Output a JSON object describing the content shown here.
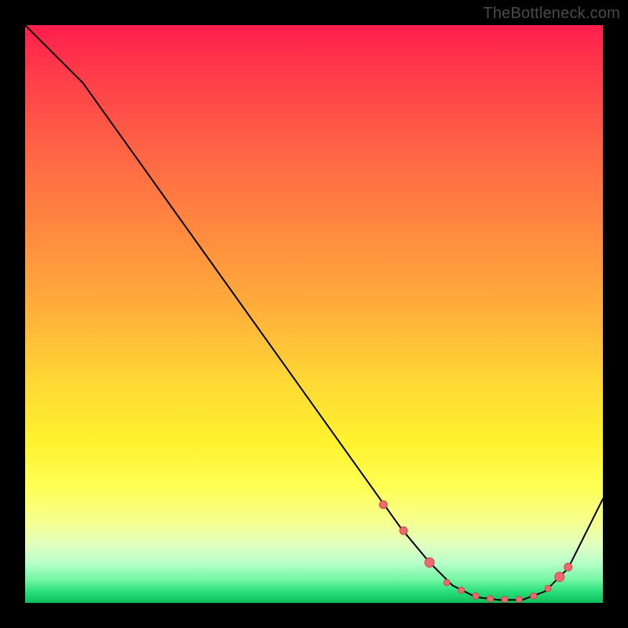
{
  "watermark": "TheBottleneck.com",
  "chart_data": {
    "type": "line",
    "title": "",
    "xlabel": "",
    "ylabel": "",
    "xlim": [
      0,
      100
    ],
    "ylim": [
      0,
      100
    ],
    "grid": false,
    "legend": false,
    "series": [
      {
        "name": "curve",
        "x": [
          0,
          6,
          10,
          20,
          30,
          40,
          50,
          60,
          65,
          70,
          74,
          78,
          82,
          86,
          90,
          94,
          100
        ],
        "values": [
          100,
          94,
          90,
          76,
          62,
          48,
          34,
          20,
          13,
          7,
          3,
          1,
          0.5,
          0.5,
          2,
          6,
          18
        ]
      }
    ],
    "markers": {
      "name": "dots",
      "x": [
        62,
        65.5,
        70,
        73,
        75.5,
        78,
        80.5,
        83,
        85.5,
        88,
        90.5,
        92.5,
        94
      ],
      "values": [
        17,
        12.5,
        7,
        3.5,
        2.2,
        1.2,
        0.7,
        0.6,
        0.6,
        1.2,
        2.5,
        4.5,
        6.2
      ],
      "radius": [
        5,
        5,
        6,
        4,
        4,
        4,
        4,
        4,
        4,
        4,
        4,
        6,
        5
      ]
    }
  }
}
